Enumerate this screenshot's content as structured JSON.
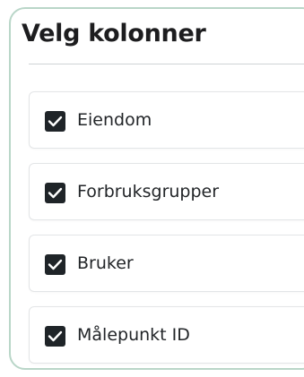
{
  "dialog": {
    "title": "Velg kolonner"
  },
  "columns": [
    {
      "label": "Eiendom",
      "checked": true
    },
    {
      "label": "Forbruksgrupper",
      "checked": true
    },
    {
      "label": "Bruker",
      "checked": true
    },
    {
      "label": "Målepunkt ID",
      "checked": true
    }
  ],
  "colors": {
    "panel_border": "#b9d6c8",
    "checkbox_fill": "#1f2428",
    "text": "#1d1d1f"
  },
  "icons": {
    "checkbox_checked": "check-icon"
  }
}
